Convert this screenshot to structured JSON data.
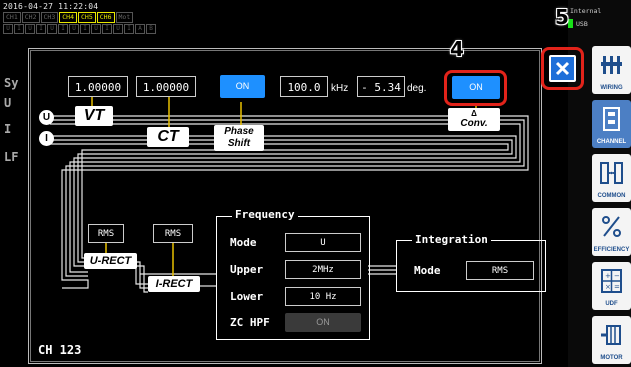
{
  "status": {
    "datetime": "2016-04-27 11:22:04",
    "channels": [
      {
        "label": "CH1",
        "active": false
      },
      {
        "label": "CH2",
        "active": false
      },
      {
        "label": "CH3",
        "active": false
      },
      {
        "label": "CH4",
        "active": true
      },
      {
        "label": "CH5",
        "active": true
      },
      {
        "label": "CH6",
        "active": true
      },
      {
        "label": "Mot",
        "active": false
      }
    ],
    "indicators": [
      "U",
      "I",
      "U",
      "I",
      "U",
      "I",
      "U",
      "I",
      "U",
      "I",
      "U",
      "I",
      "A",
      "B"
    ]
  },
  "background": {
    "labels": [
      "Sy",
      "U",
      "I",
      "LF"
    ]
  },
  "right_panel": {
    "storage": "Internal",
    "usb": "USB",
    "buttons": [
      {
        "label": "WIRING",
        "icon": "wiring-icon"
      },
      {
        "label": "CHANNEL",
        "icon": "channel-icon"
      },
      {
        "label": "COMMON",
        "icon": "common-icon"
      },
      {
        "label": "EFFICIENCY",
        "icon": "efficiency-icon"
      },
      {
        "label": "UDF",
        "icon": "udf-icon"
      },
      {
        "label": "MOTOR",
        "icon": "motor-icon"
      }
    ]
  },
  "dialog": {
    "vt_value": "1.00000",
    "ct_value": "1.00000",
    "phase_shift_state": "ON",
    "phase_freq_value": "100.0",
    "phase_freq_unit": "kHz",
    "phase_deg_value": "- 5.34",
    "phase_deg_unit": "deg.",
    "conv_state": "ON",
    "labels": {
      "u": "U",
      "i": "I",
      "vt": "VT",
      "ct": "CT",
      "phase_shift": "Phase Shift",
      "conv_delta": "Δ",
      "conv": "Conv.",
      "u_rect": "U-RECT",
      "i_rect": "I-RECT"
    },
    "u_rect_value": "RMS",
    "i_rect_value": "RMS",
    "frequency": {
      "title": "Frequency",
      "mode_label": "Mode",
      "mode_value": "U",
      "upper_label": "Upper",
      "upper_value": "2MHz",
      "lower_label": "Lower",
      "lower_value": "10 Hz",
      "zc_hpf_label": "ZC HPF",
      "zc_hpf_value": "ON"
    },
    "integration": {
      "title": "Integration",
      "mode_label": "Mode",
      "mode_value": "RMS"
    },
    "channel_label": "CH 123"
  },
  "callouts": {
    "conv_step": "4",
    "close_step": "5"
  },
  "colors": {
    "accent_blue": "#1e90ff",
    "callout_red": "#e2231a",
    "channel_yellow": "#e8e800"
  }
}
